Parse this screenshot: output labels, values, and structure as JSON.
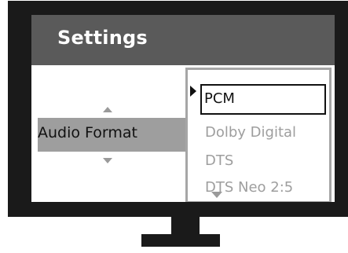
{
  "settings": {
    "title": "Settings",
    "current_setting": "Audio Format"
  },
  "dropdown": {
    "options": [
      {
        "label": "PCM",
        "selected": true
      },
      {
        "label": "Dolby Digital",
        "selected": false
      },
      {
        "label": "DTS",
        "selected": false
      },
      {
        "label": "DTS Neo 2:5",
        "selected": false
      }
    ]
  },
  "colors": {
    "frame": "#1a1a1a",
    "header": "#5a5a5a",
    "highlight_row": "#9e9e9e",
    "inactive_text": "#9e9e9e",
    "dropdown_border": "#a6a6a6"
  },
  "icons": {
    "setting_prev": "triangle-up-icon",
    "setting_next": "triangle-down-icon",
    "selector": "triangle-right-icon",
    "list_more": "triangle-down-icon"
  }
}
